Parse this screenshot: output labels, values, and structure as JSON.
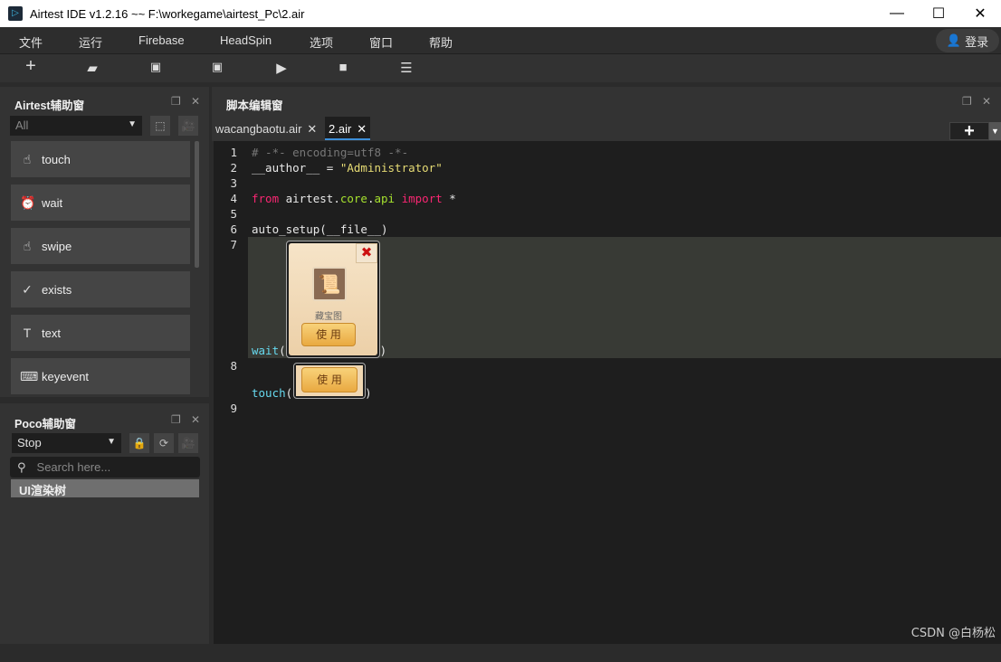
{
  "window": {
    "title": "Airtest IDE v1.2.16 ~~ F:\\workegame\\airtest_Pc\\2.air",
    "minimize": "—",
    "maximize": "☐",
    "close": "✕"
  },
  "menu": [
    "文件",
    "运行",
    "Firebase",
    "HeadSpin",
    "选项",
    "窗口",
    "帮助"
  ],
  "login": "登录",
  "toolbar": [
    "new",
    "open",
    "save",
    "save-as",
    "run",
    "stop",
    "log"
  ],
  "airtest_panel": {
    "title": "Airtest辅助窗",
    "filter": "All",
    "items": [
      {
        "label": "touch",
        "icon": "☝"
      },
      {
        "label": "wait",
        "icon": "⏰"
      },
      {
        "label": "swipe",
        "icon": "☝"
      },
      {
        "label": "exists",
        "icon": "✓"
      },
      {
        "label": "text",
        "icon": "T"
      },
      {
        "label": "keyevent",
        "icon": "⌨"
      }
    ]
  },
  "poco_panel": {
    "title": "Poco辅助窗",
    "mode": "Stop",
    "search_placeholder": "Search here...",
    "tree_header": "UI渲染树"
  },
  "editor_panel": {
    "title": "脚本编辑窗",
    "tabs": [
      {
        "label": "wacangbaotu.air",
        "active": false
      },
      {
        "label": "2.air",
        "active": true
      }
    ]
  },
  "code": {
    "line_numbers": [
      "1",
      "2",
      "3",
      "4",
      "5",
      "6",
      "7",
      "8",
      "9"
    ],
    "l1": "# -*- encoding=utf8 -*-",
    "l2a": "__author__ = ",
    "l2b": "\"Administrator\"",
    "l4a": "from",
    "l4b": " airtest.",
    "l4c": "core",
    "l4d": ".",
    "l4e": "api",
    "l4f": " import",
    "l4g": " *",
    "l6": "auto_setup(__file__)",
    "l7a": "wait",
    "l7b": "(",
    "l7c": ")",
    "l8a": "touch",
    "l8b": "(",
    "l8c": ")",
    "img1_label": "藏宝图",
    "img_button": "使 用"
  },
  "watermark": "CSDN @白杨松",
  "colors": {
    "accent": "#3c8fd9",
    "bg": "#2b2b2b",
    "editor": "#1e1e1e"
  }
}
